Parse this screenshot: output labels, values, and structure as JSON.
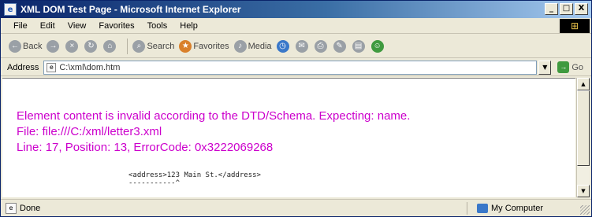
{
  "window": {
    "title": "XML DOM Test Page - Microsoft Internet Explorer",
    "controls": {
      "minimize": "_",
      "maximize": "□",
      "close": "X"
    }
  },
  "menubar": {
    "items": [
      {
        "label": "File"
      },
      {
        "label": "Edit"
      },
      {
        "label": "View"
      },
      {
        "label": "Favorites"
      },
      {
        "label": "Tools"
      },
      {
        "label": "Help"
      }
    ]
  },
  "toolbar": {
    "back_label": "Back",
    "search_label": "Search",
    "favorites_label": "Favorites",
    "media_label": "Media"
  },
  "address": {
    "label": "Address",
    "value": "C:\\xml\\dom.htm",
    "go_label": "Go"
  },
  "content": {
    "error_line_1": "Element content is invalid according to the DTD/Schema. Expecting: name.",
    "error_line_2": "File: file:///C:/xml/letter3.xml",
    "error_line_3": "Line: 17, Position: 13, ErrorCode: 0x3222069268",
    "source_line": "<address>123 Main St.</address>\\n-----------^"
  },
  "statusbar": {
    "status": "Done",
    "zone": "My Computer"
  },
  "colors": {
    "error_text": "#cc00cc",
    "titlebar": "#0a246a",
    "chrome": "#ece9d8"
  }
}
